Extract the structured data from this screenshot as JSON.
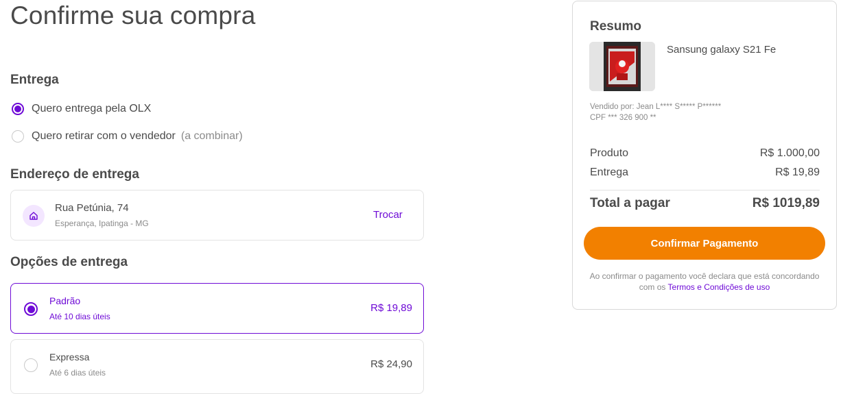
{
  "title": "Confirme sua compra",
  "delivery": {
    "heading": "Entrega",
    "options": [
      {
        "label": "Quero entrega pela OLX",
        "hint": "",
        "selected": true
      },
      {
        "label": "Quero retirar com o vendedor",
        "hint": "(a combinar)",
        "selected": false
      }
    ]
  },
  "address": {
    "heading": "Endereço de entrega",
    "icon": "home-icon",
    "street": "Rua Petúnia, 74",
    "city": "Esperança, Ipatinga - MG",
    "change_label": "Trocar"
  },
  "shipping": {
    "heading": "Opções de entrega",
    "options": [
      {
        "name": "Padrão",
        "days": "Até 10 dias úteis",
        "price": "R$ 19,89",
        "selected": true
      },
      {
        "name": "Expressa",
        "days": "Até 6 dias úteis",
        "price": "R$ 24,90",
        "selected": false
      }
    ]
  },
  "summary": {
    "heading": "Resumo",
    "product_name": "Sansung galaxy S21 Fe",
    "seller_line": "Vendido por: Jean L**** S***** P******",
    "cpf_line": "CPF *** 326 900 **",
    "product_label": "Produto",
    "product_value": "R$ 1.000,00",
    "delivery_label": "Entrega",
    "delivery_value": "R$ 19,89",
    "total_label": "Total a pagar",
    "total_value": "R$ 1019,89",
    "confirm_label": "Confirmar Pagamento",
    "terms_text": "Ao confirmar o pagamento você declara que está concordando com os",
    "terms_link": "Termos e Condições de uso"
  },
  "colors": {
    "accent": "#6e0ad6",
    "button": "#f28000",
    "text": "#4a4a4a",
    "muted": "#8a8a8a"
  }
}
